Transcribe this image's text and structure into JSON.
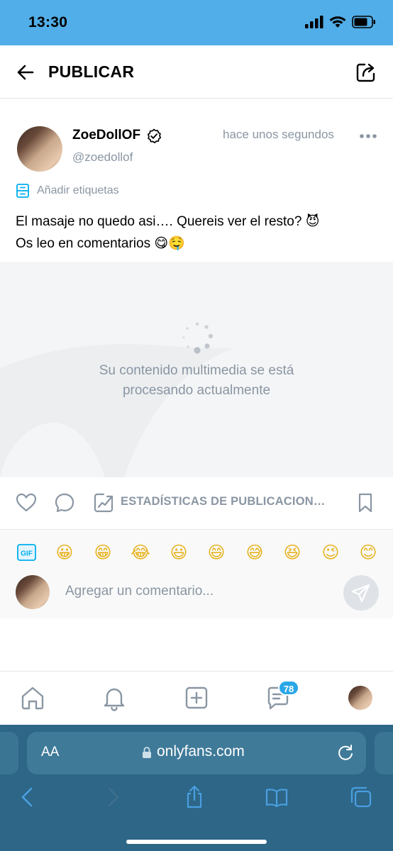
{
  "status_bar": {
    "time": "13:30"
  },
  "header": {
    "title": "PUBLICAR"
  },
  "post": {
    "username": "ZoeDollOF",
    "handle": "@zoedollof",
    "timestamp": "hace unos segundos",
    "tags_label": "Añadir etiquetas",
    "text_line1": "El masaje no quedo asi…. Quereis ver el resto? 😈",
    "text_line2": "Os leo en comentarios 😋🤤",
    "media_message": "Su contenido multimedia se está procesando actualmente"
  },
  "actions": {
    "stats_label": "ESTADÍSTICAS DE PUBLICACION…"
  },
  "emoji_bar": {
    "gif_label": "GIF",
    "emojis": [
      "😀",
      "😁",
      "😂",
      "😃",
      "😄",
      "😅",
      "😆",
      "😉",
      "😊"
    ]
  },
  "comment": {
    "placeholder": "Agregar un comentario..."
  },
  "bottom_nav": {
    "messages_badge": "78"
  },
  "browser": {
    "text_size_label": "AA",
    "url": "onlyfans.com"
  },
  "colors": {
    "accent": "#00aff0",
    "status_bar": "#52aee8",
    "muted": "#8a96a3",
    "browser": "#2d6687"
  }
}
